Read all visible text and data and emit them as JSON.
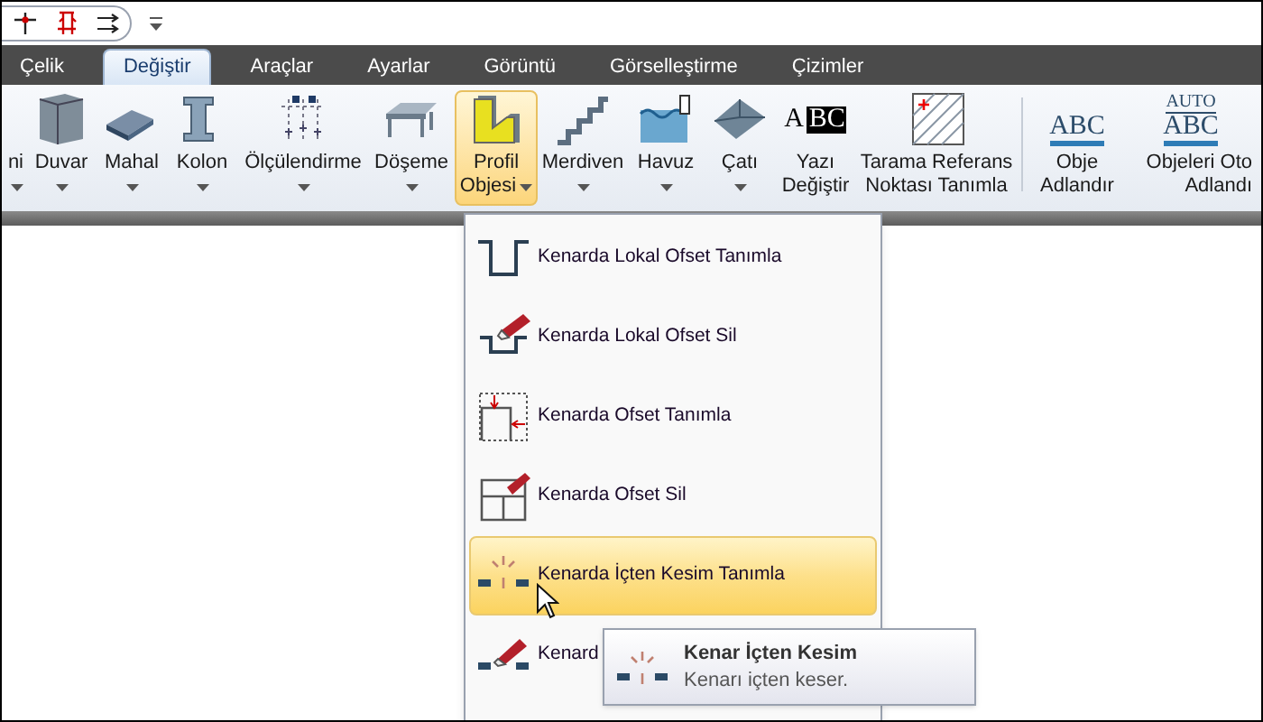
{
  "tabs": [
    {
      "label": "Çelik",
      "selected": false
    },
    {
      "label": "Değiştir",
      "selected": true
    },
    {
      "label": "Araçlar",
      "selected": false
    },
    {
      "label": "Ayarlar",
      "selected": false
    },
    {
      "label": "Görüntü",
      "selected": false
    },
    {
      "label": "Görselleştirme",
      "selected": false
    },
    {
      "label": "Çizimler",
      "selected": false
    }
  ],
  "ribbon": [
    {
      "lines": [
        "ni"
      ],
      "dropdown": true,
      "selected": false
    },
    {
      "lines": [
        "Duvar"
      ],
      "dropdown": true,
      "selected": false
    },
    {
      "lines": [
        "Mahal"
      ],
      "dropdown": true,
      "selected": false
    },
    {
      "lines": [
        "Kolon"
      ],
      "dropdown": true,
      "selected": false
    },
    {
      "lines": [
        "Ölçülendirme"
      ],
      "dropdown": true,
      "selected": false
    },
    {
      "lines": [
        "Döşeme"
      ],
      "dropdown": true,
      "selected": false
    },
    {
      "lines": [
        "Profil",
        "Objesi"
      ],
      "dropdown": true,
      "selected": true
    },
    {
      "lines": [
        "Merdiven"
      ],
      "dropdown": true,
      "selected": false
    },
    {
      "lines": [
        "Havuz"
      ],
      "dropdown": true,
      "selected": false
    },
    {
      "lines": [
        "Çatı"
      ],
      "dropdown": true,
      "selected": false
    },
    {
      "lines": [
        "Yazı",
        "Değiştir"
      ],
      "dropdown": false,
      "selected": false,
      "icon_text": [
        "A",
        "BC"
      ]
    },
    {
      "lines": [
        "Tarama Referans",
        "Noktası Tanımla"
      ],
      "dropdown": false,
      "selected": false
    },
    {
      "lines": [
        "Obje",
        "Adlandır"
      ],
      "dropdown": false,
      "selected": false,
      "icon_text": [
        "ABC"
      ]
    },
    {
      "lines": [
        "Objeleri Oto",
        "Adlandı"
      ],
      "dropdown": false,
      "selected": false,
      "icon_text": [
        "AUTO",
        "ABC"
      ]
    }
  ],
  "menu": [
    {
      "label": "Kenarda Lokal Ofset Tanımla",
      "selected": false
    },
    {
      "label": "Kenarda Lokal Ofset Sil",
      "selected": false
    },
    {
      "label": "Kenarda Ofset Tanımla",
      "selected": false
    },
    {
      "label": "Kenarda Ofset Sil",
      "selected": false
    },
    {
      "label": "Kenarda İçten Kesim Tanımla",
      "selected": true
    },
    {
      "label": "Kenard",
      "selected": false
    }
  ],
  "tooltip": {
    "title": "Kenar İçten Kesim",
    "description": "Kenarı içten keser."
  }
}
